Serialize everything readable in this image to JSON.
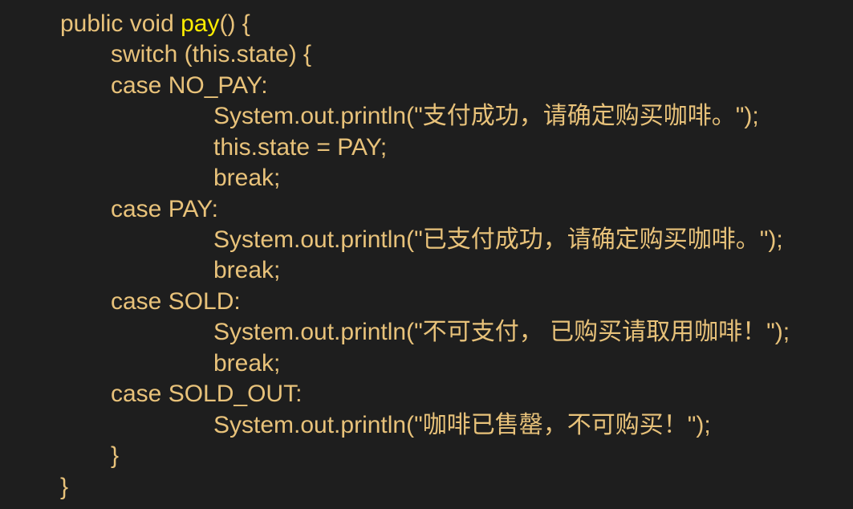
{
  "colors": {
    "background": "#1e1e1e",
    "text": "#e8c27a",
    "method_name": "#ffee00"
  },
  "code": {
    "l1_pre": "public void ",
    "l1_method": "pay",
    "l1_post": "() {",
    "l2": "switch (this.state) {",
    "l3": "case NO_PAY:",
    "l4": "System.out.println(\"支付成功，请确定购买咖啡。\");",
    "l5": "this.state = PAY;",
    "l6": "break;",
    "l7": "case PAY:",
    "l8": "System.out.println(\"已支付成功，请确定购买咖啡。\");",
    "l9": "break;",
    "l10": "case SOLD:",
    "l11": "System.out.println(\"不可支付， 已购买请取用咖啡！\");",
    "l12": "break;",
    "l13": "case SOLD_OUT:",
    "l14": "System.out.println(\"咖啡已售罄，不可购买！\");",
    "l15": "}",
    "l16": "}"
  }
}
